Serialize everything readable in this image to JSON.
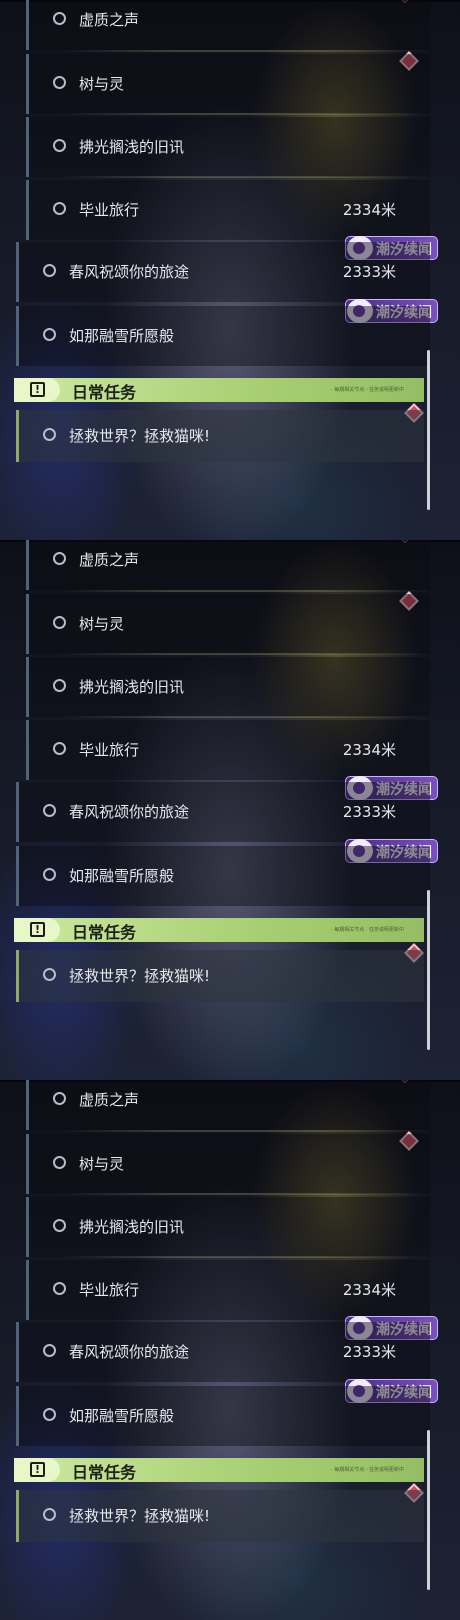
{
  "panels": [
    {
      "quests": [
        {
          "label": "虚质之声",
          "distance": ""
        },
        {
          "label": "树与灵",
          "distance": ""
        },
        {
          "label": "拂光搁浅的旧讯",
          "distance": ""
        },
        {
          "label": "毕业旅行",
          "distance": "2334米"
        },
        {
          "label": "春风祝颂你的旅途",
          "distance": "2333米"
        },
        {
          "label": "如那融雪所愿般",
          "distance": ""
        }
      ],
      "badges": [
        "潮汐续闻",
        "潮汐续闻"
      ],
      "daily": {
        "title": "日常任务",
        "small_text": "· 每期相关节点 · 任务说明更新中",
        "quest": "拯救世界？拯救猫咪!"
      }
    },
    {
      "quests": [
        {
          "label": "虚质之声",
          "distance": ""
        },
        {
          "label": "树与灵",
          "distance": ""
        },
        {
          "label": "拂光搁浅的旧讯",
          "distance": ""
        },
        {
          "label": "毕业旅行",
          "distance": "2334米"
        },
        {
          "label": "春风祝颂你的旅途",
          "distance": "2333米"
        },
        {
          "label": "如那融雪所愿般",
          "distance": ""
        }
      ],
      "badges": [
        "潮汐续闻",
        "潮汐续闻"
      ],
      "daily": {
        "title": "日常任务",
        "small_text": "· 每期相关节点 · 任务说明更新中",
        "quest": "拯救世界？拯救猫咪!"
      }
    },
    {
      "quests": [
        {
          "label": "虚质之声",
          "distance": ""
        },
        {
          "label": "树与灵",
          "distance": ""
        },
        {
          "label": "拂光搁浅的旧讯",
          "distance": ""
        },
        {
          "label": "毕业旅行",
          "distance": "2334米"
        },
        {
          "label": "春风祝颂你的旅途",
          "distance": "2333米"
        },
        {
          "label": "如那融雪所愿般",
          "distance": ""
        }
      ],
      "badges": [
        "潮汐续闻",
        "潮汐续闻"
      ],
      "daily": {
        "title": "日常任务",
        "small_text": "· 每期相关节点 · 任务说明更新中",
        "quest": "拯救世界？拯救猫咪!"
      }
    }
  ],
  "colors": {
    "daily_bar": "#a7cf72",
    "badge": "#6a3fb0",
    "marker": "#d64a5c",
    "row_border": "#4f6478"
  },
  "icons": [
    "radio-circle-icon",
    "red-diamond-marker-icon",
    "tidal-swirl-icon",
    "exclamation-box-icon"
  ]
}
